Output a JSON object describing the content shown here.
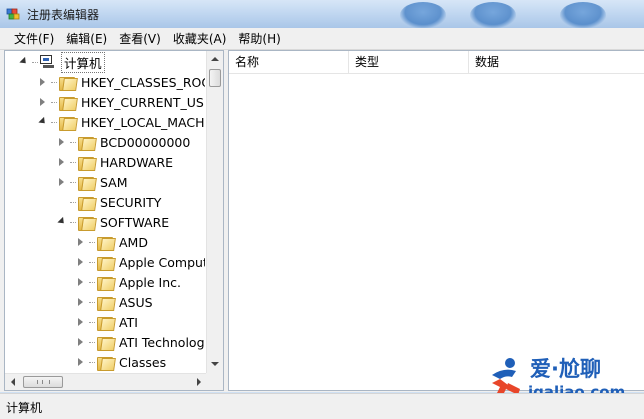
{
  "window": {
    "title": "注册表编辑器"
  },
  "menu": [
    {
      "label": "文件(F)"
    },
    {
      "label": "编辑(E)"
    },
    {
      "label": "查看(V)"
    },
    {
      "label": "收藏夹(A)"
    },
    {
      "label": "帮助(H)"
    }
  ],
  "tree": [
    {
      "label": "计算机",
      "icon": "computer-icon",
      "depth": 0,
      "expander": "expanded",
      "selected": true
    },
    {
      "label": "HKEY_CLASSES_ROOT",
      "icon": "folder-icon",
      "depth": 1,
      "expander": "collapsed"
    },
    {
      "label": "HKEY_CURRENT_USER",
      "icon": "folder-icon",
      "depth": 1,
      "expander": "collapsed"
    },
    {
      "label": "HKEY_LOCAL_MACHINE",
      "icon": "folder-icon",
      "depth": 1,
      "expander": "expanded"
    },
    {
      "label": "BCD00000000",
      "icon": "folder-icon",
      "depth": 2,
      "expander": "collapsed"
    },
    {
      "label": "HARDWARE",
      "icon": "folder-icon",
      "depth": 2,
      "expander": "collapsed"
    },
    {
      "label": "SAM",
      "icon": "folder-icon",
      "depth": 2,
      "expander": "collapsed"
    },
    {
      "label": "SECURITY",
      "icon": "folder-icon",
      "depth": 2,
      "expander": "none"
    },
    {
      "label": "SOFTWARE",
      "icon": "folder-icon",
      "depth": 2,
      "expander": "expanded"
    },
    {
      "label": "AMD",
      "icon": "folder-icon",
      "depth": 3,
      "expander": "collapsed"
    },
    {
      "label": "Apple Computer",
      "icon": "folder-icon",
      "depth": 3,
      "expander": "collapsed"
    },
    {
      "label": "Apple Inc.",
      "icon": "folder-icon",
      "depth": 3,
      "expander": "collapsed"
    },
    {
      "label": "ASUS",
      "icon": "folder-icon",
      "depth": 3,
      "expander": "collapsed"
    },
    {
      "label": "ATI",
      "icon": "folder-icon",
      "depth": 3,
      "expander": "collapsed"
    },
    {
      "label": "ATI Technologie",
      "icon": "folder-icon",
      "depth": 3,
      "expander": "collapsed"
    },
    {
      "label": "Classes",
      "icon": "folder-icon",
      "depth": 3,
      "expander": "collapsed"
    }
  ],
  "columns": [
    {
      "label": "名称"
    },
    {
      "label": "类型"
    },
    {
      "label": "数据"
    }
  ],
  "status": {
    "path": "计算机"
  },
  "watermark": {
    "top": "爱·尬聊",
    "bottom": "igaliao.com"
  },
  "colors": {
    "watermark": "#1f5fb8",
    "watermark_accent": "#e8462a",
    "titlebar": "#c2d8f1"
  }
}
